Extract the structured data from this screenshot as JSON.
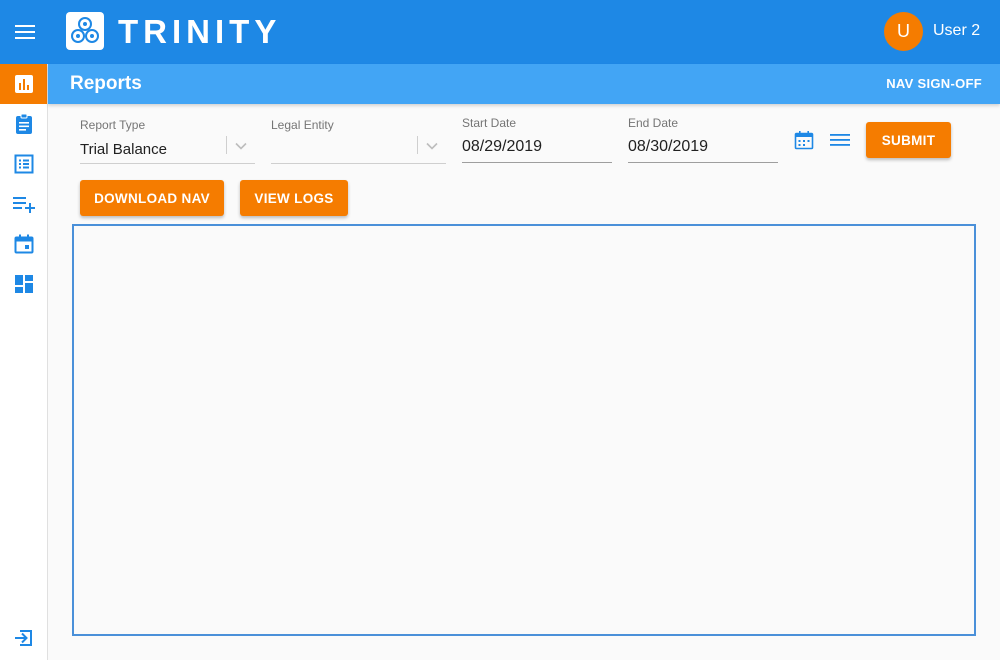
{
  "app": {
    "brand": "TRINITY",
    "user_initial": "U",
    "user_name": "User 2"
  },
  "header": {
    "title": "Reports",
    "nav_signoff_label": "NAV SIGN-OFF"
  },
  "sidebar": {
    "items": [
      {
        "name": "reports",
        "icon": "bar-chart-icon",
        "active": true
      },
      {
        "name": "clipboard",
        "icon": "clipboard-icon",
        "active": false
      },
      {
        "name": "list",
        "icon": "list-icon",
        "active": false
      },
      {
        "name": "add-list",
        "icon": "playlist-add-icon",
        "active": false
      },
      {
        "name": "calendar",
        "icon": "calendar-icon",
        "active": false
      },
      {
        "name": "dashboard",
        "icon": "dashboard-icon",
        "active": false
      }
    ],
    "bottom_icon": "logout-icon"
  },
  "form": {
    "report_type": {
      "label": "Report Type",
      "value": "Trial Balance"
    },
    "legal_entity": {
      "label": "Legal Entity",
      "value": ""
    },
    "start_date": {
      "label": "Start Date",
      "value": "08/29/2019"
    },
    "end_date": {
      "label": "End Date",
      "value": "08/30/2019"
    },
    "submit_label": "SUBMIT"
  },
  "actions": {
    "download_nav_label": "DOWNLOAD NAV",
    "view_logs_label": "VIEW LOGS"
  },
  "colors": {
    "topbar": "#1e88e5",
    "subheader": "#42a5f5",
    "accent": "#f57c00",
    "panel_border": "#4a90d9"
  }
}
